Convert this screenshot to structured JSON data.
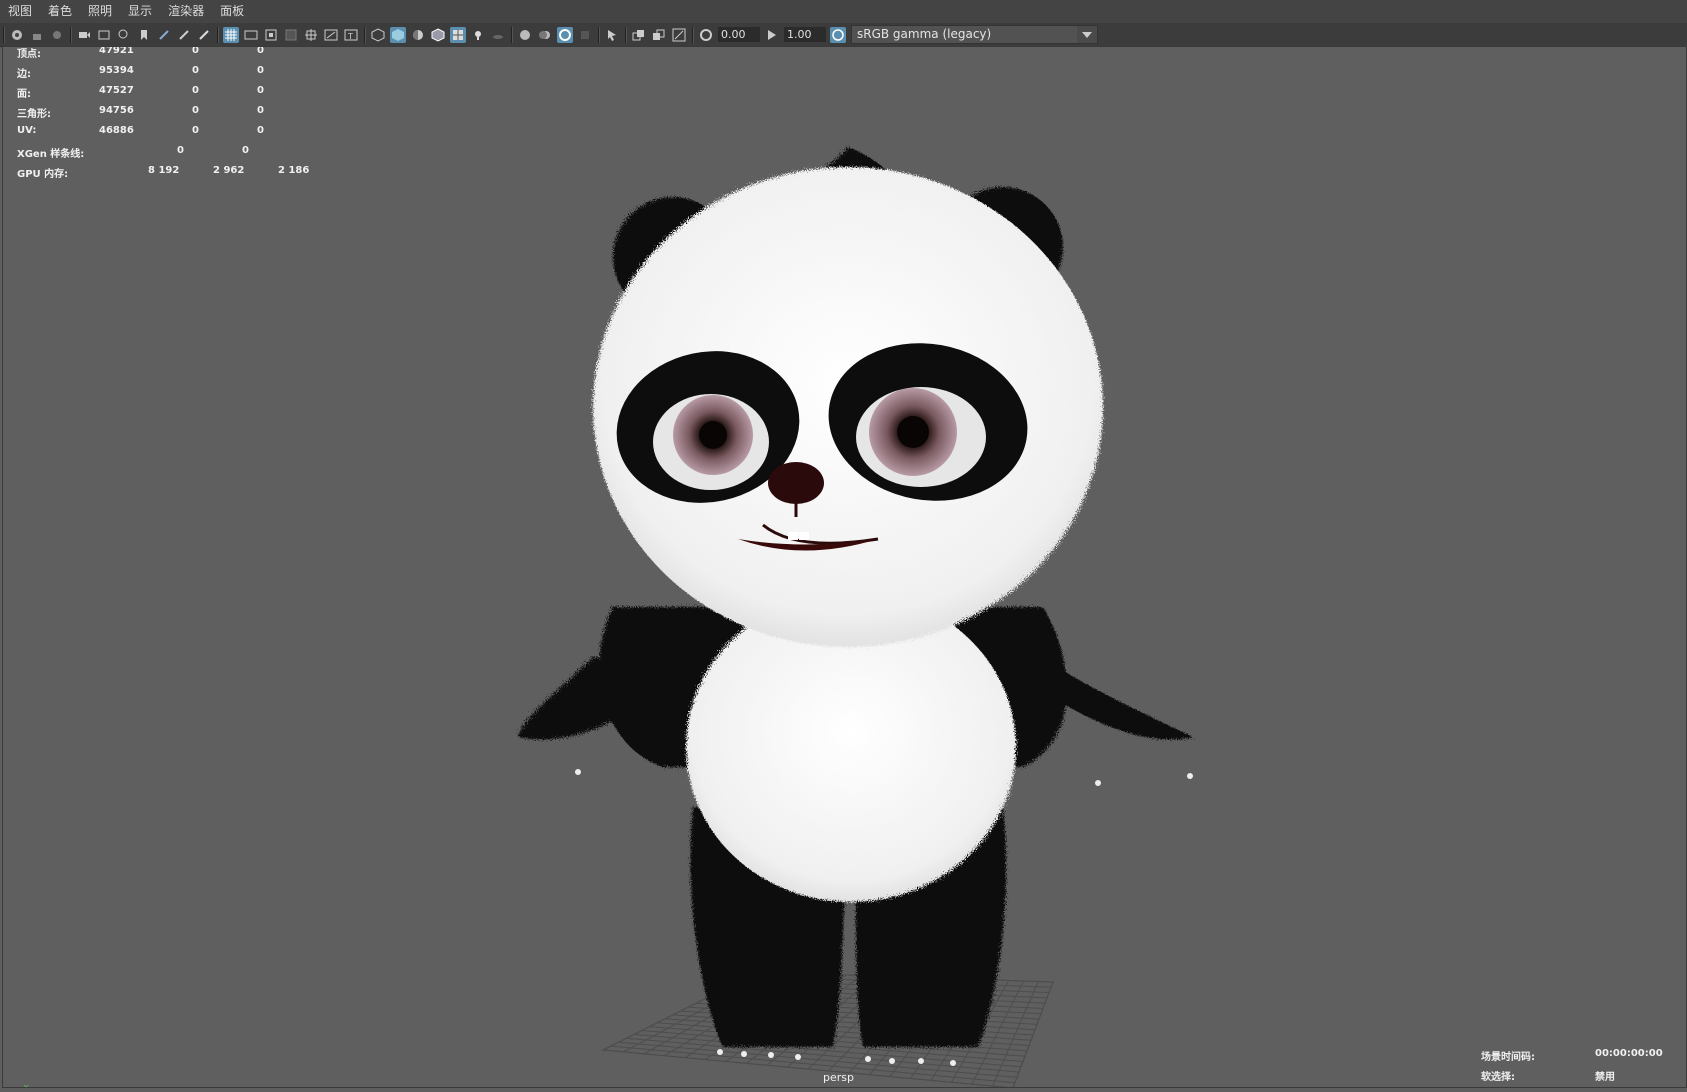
{
  "menu": {
    "items": [
      "视图",
      "着色",
      "照明",
      "显示",
      "渲染器",
      "面板"
    ]
  },
  "toolbar": {
    "exposure": "0.00",
    "gamma": "1.00",
    "color_space": "sRGB gamma (legacy)"
  },
  "hud": {
    "rows": [
      {
        "label": "顶点:",
        "values": [
          "47921",
          "0",
          "0"
        ]
      },
      {
        "label": "边:",
        "values": [
          "95394",
          "0",
          "0"
        ]
      },
      {
        "label": "面:",
        "values": [
          "47527",
          "0",
          "0"
        ]
      },
      {
        "label": "三角形:",
        "values": [
          "94756",
          "0",
          "0"
        ]
      },
      {
        "label": "UV:",
        "values": [
          "46886",
          "0",
          "0"
        ]
      },
      {
        "label": "XGen 样条线:",
        "values": [
          "0",
          "0"
        ]
      },
      {
        "label": "GPU 内存:",
        "values": [
          "8 192",
          "2 962",
          "2 186"
        ]
      }
    ]
  },
  "camera_name": "persp",
  "bottom_right": {
    "timecode_label": "场景时间码:",
    "timecode_value": "00:00:00:00",
    "soft_select_label": "软选择:",
    "soft_select_value": "禁用"
  },
  "colors": {
    "viewport_bg": "#5f5f5f",
    "menubar": "#444444",
    "toolbar": "#3c3c3c",
    "active_icon": "#5a8fb0"
  }
}
